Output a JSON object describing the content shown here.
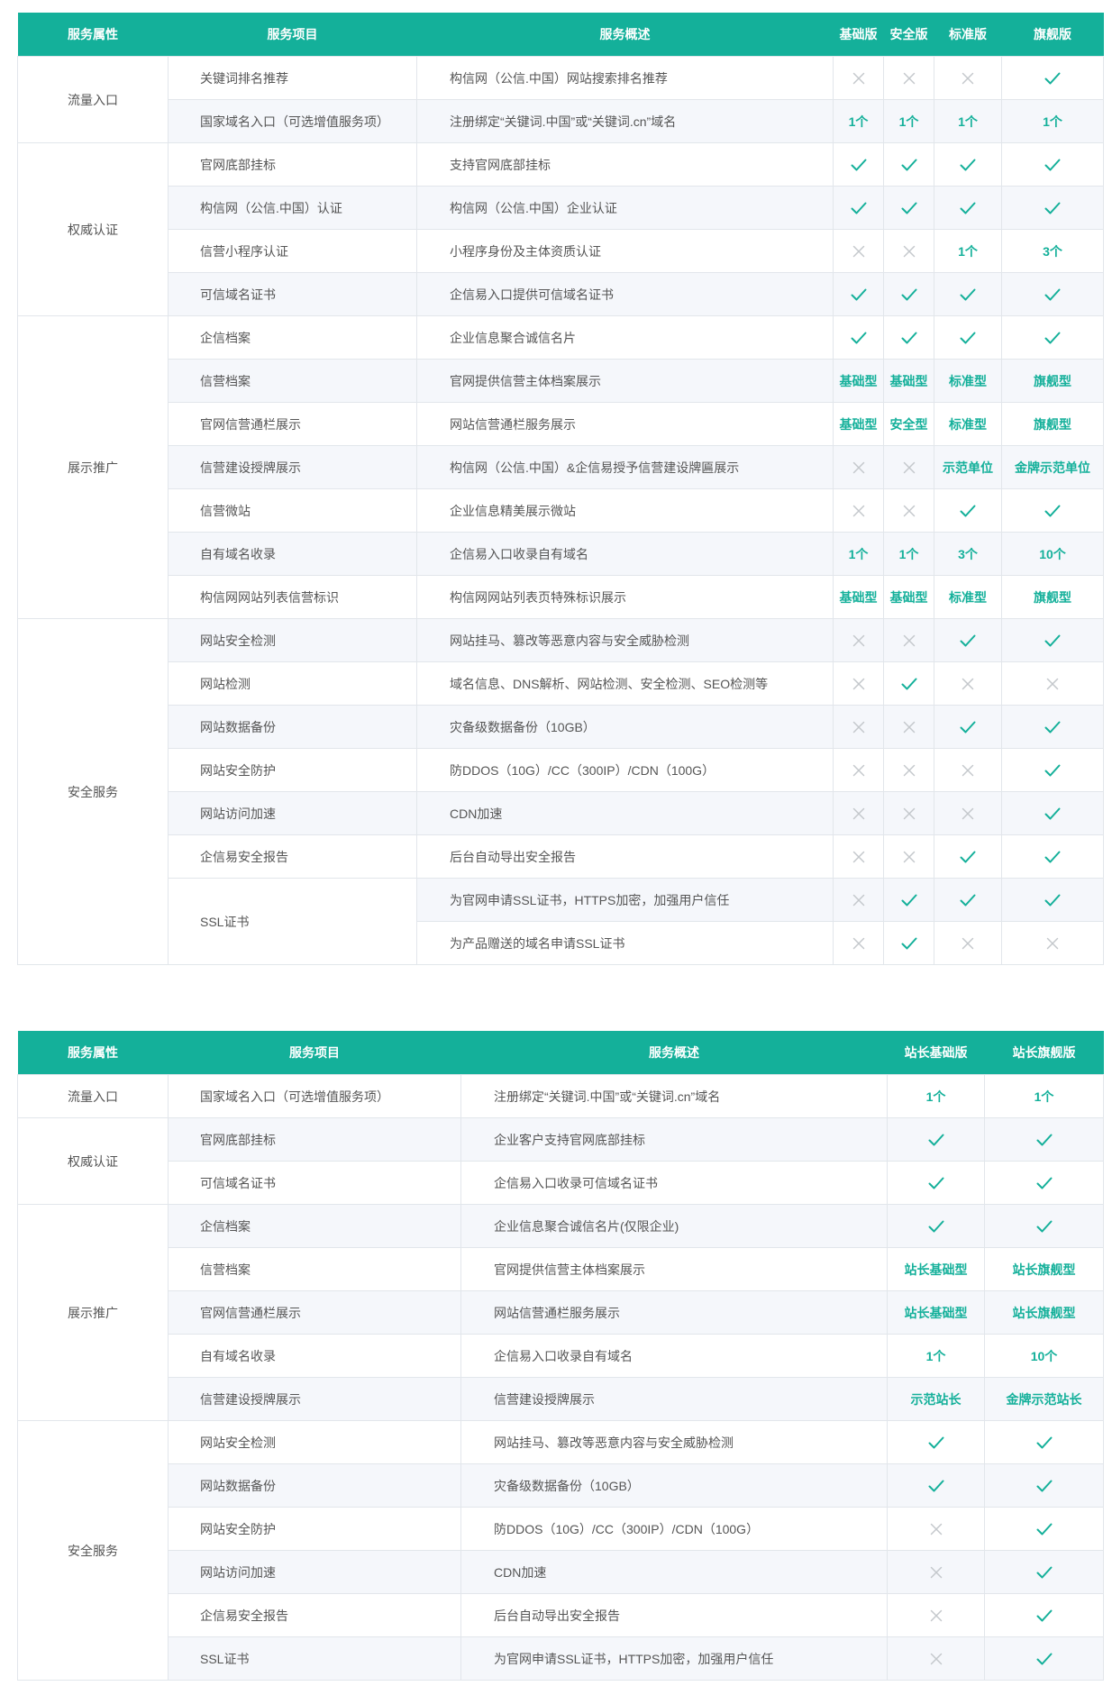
{
  "colors": {
    "accent": "#14b09a",
    "cross": "#c4c8cc",
    "border": "#e2e6eb",
    "row_alt": "#f5f7fb"
  },
  "icons": {
    "yes": "check-icon",
    "no": "cross-icon"
  },
  "table1": {
    "headers": {
      "attr": "服务属性",
      "item": "服务项目",
      "desc": "服务概述",
      "plans": [
        "基础版",
        "安全版",
        "标准版",
        "旗舰版"
      ]
    },
    "groups": [
      {
        "name": "流量入口",
        "rows": [
          {
            "item": "关键词排名推荐",
            "desc": "构信网（公信.中国）网站搜索排名推荐",
            "vals": [
              "no",
              "no",
              "no",
              "yes"
            ]
          },
          {
            "item": "国家域名入口（可选增值服务项）",
            "desc": "注册绑定“关键词.中国”或“关键词.cn”域名",
            "vals": [
              "1个",
              "1个",
              "1个",
              "1个"
            ]
          }
        ]
      },
      {
        "name": "权威认证",
        "rows": [
          {
            "item": "官网底部挂标",
            "desc": "支持官网底部挂标",
            "vals": [
              "yes",
              "yes",
              "yes",
              "yes"
            ]
          },
          {
            "item": "构信网（公信.中国）认证",
            "desc": "构信网（公信.中国）企业认证",
            "vals": [
              "yes",
              "yes",
              "yes",
              "yes"
            ]
          },
          {
            "item": "信营小程序认证",
            "desc": "小程序身份及主体资质认证",
            "vals": [
              "no",
              "no",
              "1个",
              "3个"
            ]
          },
          {
            "item": "可信域名证书",
            "desc": "企信易入口提供可信域名证书",
            "vals": [
              "yes",
              "yes",
              "yes",
              "yes"
            ]
          }
        ]
      },
      {
        "name": "展示推广",
        "rows": [
          {
            "item": "企信档案",
            "desc": "企业信息聚合诚信名片",
            "vals": [
              "yes",
              "yes",
              "yes",
              "yes"
            ]
          },
          {
            "item": "信营档案",
            "desc": "官网提供信营主体档案展示",
            "vals": [
              "基础型",
              "基础型",
              "标准型",
              "旗舰型"
            ]
          },
          {
            "item": "官网信营通栏展示",
            "desc": "网站信营通栏服务展示",
            "vals": [
              "基础型",
              "安全型",
              "标准型",
              "旗舰型"
            ]
          },
          {
            "item": "信营建设授牌展示",
            "desc": "构信网（公信.中国）&企信易授予信营建设牌匾展示",
            "vals": [
              "no",
              "no",
              "示范单位",
              "金牌示范单位"
            ]
          },
          {
            "item": "信营微站",
            "desc": "企业信息精美展示微站",
            "vals": [
              "no",
              "no",
              "yes",
              "yes"
            ]
          },
          {
            "item": "自有域名收录",
            "desc": "企信易入口收录自有域名",
            "vals": [
              "1个",
              "1个",
              "3个",
              "10个"
            ]
          },
          {
            "item": "构信网网站列表信营标识",
            "desc": "构信网网站列表页特殊标识展示",
            "vals": [
              "基础型",
              "基础型",
              "标准型",
              "旗舰型"
            ]
          }
        ]
      },
      {
        "name": "安全服务",
        "rows": [
          {
            "item": "网站安全检测",
            "desc": "网站挂马、篡改等恶意内容与安全威胁检测",
            "vals": [
              "no",
              "no",
              "yes",
              "yes"
            ]
          },
          {
            "item": "网站检测",
            "desc": "域名信息、DNS解析、网站检测、安全检测、SEO检测等",
            "vals": [
              "no",
              "yes",
              "no",
              "no"
            ]
          },
          {
            "item": "网站数据备份",
            "desc": "灾备级数据备份（10GB）",
            "vals": [
              "no",
              "no",
              "yes",
              "yes"
            ]
          },
          {
            "item": "网站安全防护",
            "desc": "防DDOS（10G）/CC（300IP）/CDN（100G）",
            "vals": [
              "no",
              "no",
              "no",
              "yes"
            ]
          },
          {
            "item": "网站访问加速",
            "desc": "CDN加速",
            "vals": [
              "no",
              "no",
              "no",
              "yes"
            ]
          },
          {
            "item": "企信易安全报告",
            "desc": "后台自动导出安全报告",
            "vals": [
              "no",
              "no",
              "yes",
              "yes"
            ]
          },
          {
            "item": "SSL证书",
            "desc": "为官网申请SSL证书，HTTPS加密，加强用户信任",
            "vals": [
              "no",
              "yes",
              "yes",
              "yes"
            ]
          },
          {
            "item": "",
            "desc": "为产品赠送的域名申请SSL证书",
            "vals": [
              "no",
              "yes",
              "no",
              "no"
            ]
          }
        ]
      }
    ]
  },
  "table2": {
    "headers": {
      "attr": "服务属性",
      "item": "服务项目",
      "desc": "服务概述",
      "plans": [
        "站长基础版",
        "站长旗舰版"
      ]
    },
    "groups": [
      {
        "name": "流量入口",
        "rows": [
          {
            "item": "国家域名入口（可选增值服务项）",
            "desc": "注册绑定“关键词.中国”或“关键词.cn”域名",
            "vals": [
              "1个",
              "1个"
            ]
          }
        ]
      },
      {
        "name": "权威认证",
        "rows": [
          {
            "item": "官网底部挂标",
            "desc": "企业客户支持官网底部挂标",
            "vals": [
              "yes",
              "yes"
            ]
          },
          {
            "item": "可信域名证书",
            "desc": "企信易入口收录可信域名证书",
            "vals": [
              "yes",
              "yes"
            ]
          }
        ]
      },
      {
        "name": "展示推广",
        "rows": [
          {
            "item": "企信档案",
            "desc": "企业信息聚合诚信名片(仅限企业)",
            "vals": [
              "yes",
              "yes"
            ]
          },
          {
            "item": "信营档案",
            "desc": "官网提供信营主体档案展示",
            "vals": [
              "站长基础型",
              "站长旗舰型"
            ]
          },
          {
            "item": "官网信营通栏展示",
            "desc": "网站信营通栏服务展示",
            "vals": [
              "站长基础型",
              "站长旗舰型"
            ]
          },
          {
            "item": "自有域名收录",
            "desc": "企信易入口收录自有域名",
            "vals": [
              "1个",
              "10个"
            ]
          },
          {
            "item": "信营建设授牌展示",
            "desc": "信营建设授牌展示",
            "vals": [
              "示范站长",
              "金牌示范站长"
            ]
          }
        ]
      },
      {
        "name": "安全服务",
        "rows": [
          {
            "item": "网站安全检测",
            "desc": "网站挂马、篡改等恶意内容与安全威胁检测",
            "vals": [
              "yes",
              "yes"
            ]
          },
          {
            "item": "网站数据备份",
            "desc": "灾备级数据备份（10GB）",
            "vals": [
              "yes",
              "yes"
            ]
          },
          {
            "item": "网站安全防护",
            "desc": "防DDOS（10G）/CC（300IP）/CDN（100G）",
            "vals": [
              "no",
              "yes"
            ]
          },
          {
            "item": "网站访问加速",
            "desc": "CDN加速",
            "vals": [
              "no",
              "yes"
            ]
          },
          {
            "item": "企信易安全报告",
            "desc": "后台自动导出安全报告",
            "vals": [
              "no",
              "yes"
            ]
          },
          {
            "item": "SSL证书",
            "desc": "为官网申请SSL证书，HTTPS加密，加强用户信任",
            "vals": [
              "no",
              "yes"
            ]
          }
        ]
      }
    ]
  }
}
